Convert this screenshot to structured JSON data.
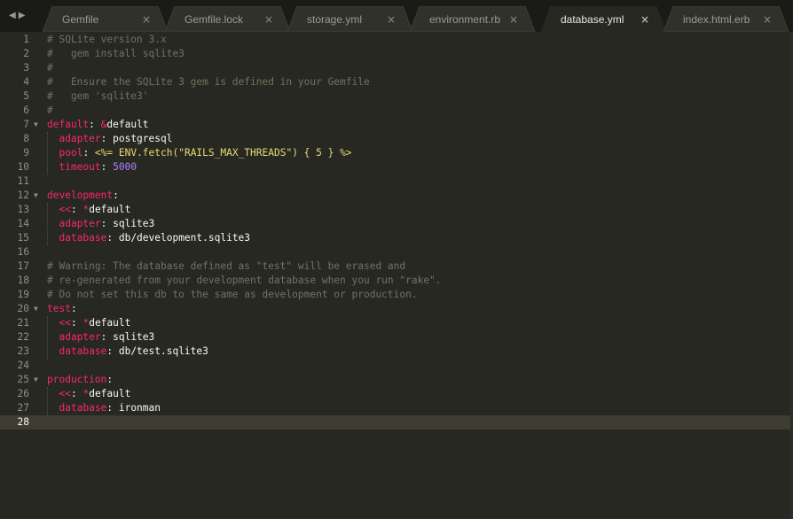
{
  "window": {
    "nav_back": "◀",
    "nav_forward": "▶",
    "active_tab": 4
  },
  "tabs": [
    {
      "label": "Gemfile",
      "close": "×"
    },
    {
      "label": "Gemfile.lock",
      "close": "×"
    },
    {
      "label": "storage.yml",
      "close": "×"
    },
    {
      "label": "environment.rb",
      "close": "×"
    },
    {
      "label": "database.yml",
      "close": "×"
    },
    {
      "label": "index.html.erb",
      "close": "×"
    }
  ],
  "editor": {
    "current_line": 28,
    "colors": {
      "background": "#272822",
      "comment": "#75715e",
      "key": "#f92672",
      "plain": "#f8f8f2",
      "string": "#e6db74",
      "number": "#ae81ff"
    },
    "fold_icon": "caret-down-icon",
    "folds": [
      7,
      12,
      20,
      25
    ],
    "lines": [
      [
        [
          "comment",
          "# SQLite version 3.x"
        ]
      ],
      [
        [
          "comment",
          "#   gem install sqlite3"
        ]
      ],
      [
        [
          "comment",
          "#"
        ]
      ],
      [
        [
          "comment",
          "#   Ensure the SQLite 3 gem is defined in your Gemfile"
        ]
      ],
      [
        [
          "comment",
          "#   gem 'sqlite3'"
        ]
      ],
      [
        [
          "comment",
          "#"
        ]
      ],
      [
        [
          "key",
          "default"
        ],
        [
          "plain",
          ": "
        ],
        [
          "key",
          "&"
        ],
        [
          "plain",
          "default"
        ]
      ],
      [
        [
          "plain",
          "  "
        ],
        [
          "key",
          "adapter"
        ],
        [
          "plain",
          ": postgresql"
        ]
      ],
      [
        [
          "plain",
          "  "
        ],
        [
          "key",
          "pool"
        ],
        [
          "plain",
          ": "
        ],
        [
          "string",
          "<%= ENV.fetch(\"RAILS_MAX_THREADS\") { 5 } %>"
        ]
      ],
      [
        [
          "plain",
          "  "
        ],
        [
          "key",
          "timeout"
        ],
        [
          "plain",
          ": "
        ],
        [
          "number",
          "5000"
        ]
      ],
      [],
      [
        [
          "key",
          "development"
        ],
        [
          "plain",
          ":"
        ]
      ],
      [
        [
          "plain",
          "  "
        ],
        [
          "key",
          "<<"
        ],
        [
          "plain",
          ": "
        ],
        [
          "key",
          "*"
        ],
        [
          "plain",
          "default"
        ]
      ],
      [
        [
          "plain",
          "  "
        ],
        [
          "key",
          "adapter"
        ],
        [
          "plain",
          ": sqlite3"
        ]
      ],
      [
        [
          "plain",
          "  "
        ],
        [
          "key",
          "database"
        ],
        [
          "plain",
          ": db/development.sqlite3"
        ]
      ],
      [],
      [
        [
          "comment",
          "# Warning: The database defined as \"test\" will be erased and"
        ]
      ],
      [
        [
          "comment",
          "# re-generated from your development database when you run \"rake\"."
        ]
      ],
      [
        [
          "comment",
          "# Do not set this db to the same as development or production."
        ]
      ],
      [
        [
          "key",
          "test"
        ],
        [
          "plain",
          ":"
        ]
      ],
      [
        [
          "plain",
          "  "
        ],
        [
          "key",
          "<<"
        ],
        [
          "plain",
          ": "
        ],
        [
          "key",
          "*"
        ],
        [
          "plain",
          "default"
        ]
      ],
      [
        [
          "plain",
          "  "
        ],
        [
          "key",
          "adapter"
        ],
        [
          "plain",
          ": sqlite3"
        ]
      ],
      [
        [
          "plain",
          "  "
        ],
        [
          "key",
          "database"
        ],
        [
          "plain",
          ": db/test.sqlite3"
        ]
      ],
      [],
      [
        [
          "key",
          "production"
        ],
        [
          "plain",
          ":"
        ]
      ],
      [
        [
          "plain",
          "  "
        ],
        [
          "key",
          "<<"
        ],
        [
          "plain",
          ": "
        ],
        [
          "key",
          "*"
        ],
        [
          "plain",
          "default"
        ]
      ],
      [
        [
          "plain",
          "  "
        ],
        [
          "key",
          "database"
        ],
        [
          "plain",
          ": ironman"
        ]
      ],
      []
    ]
  }
}
